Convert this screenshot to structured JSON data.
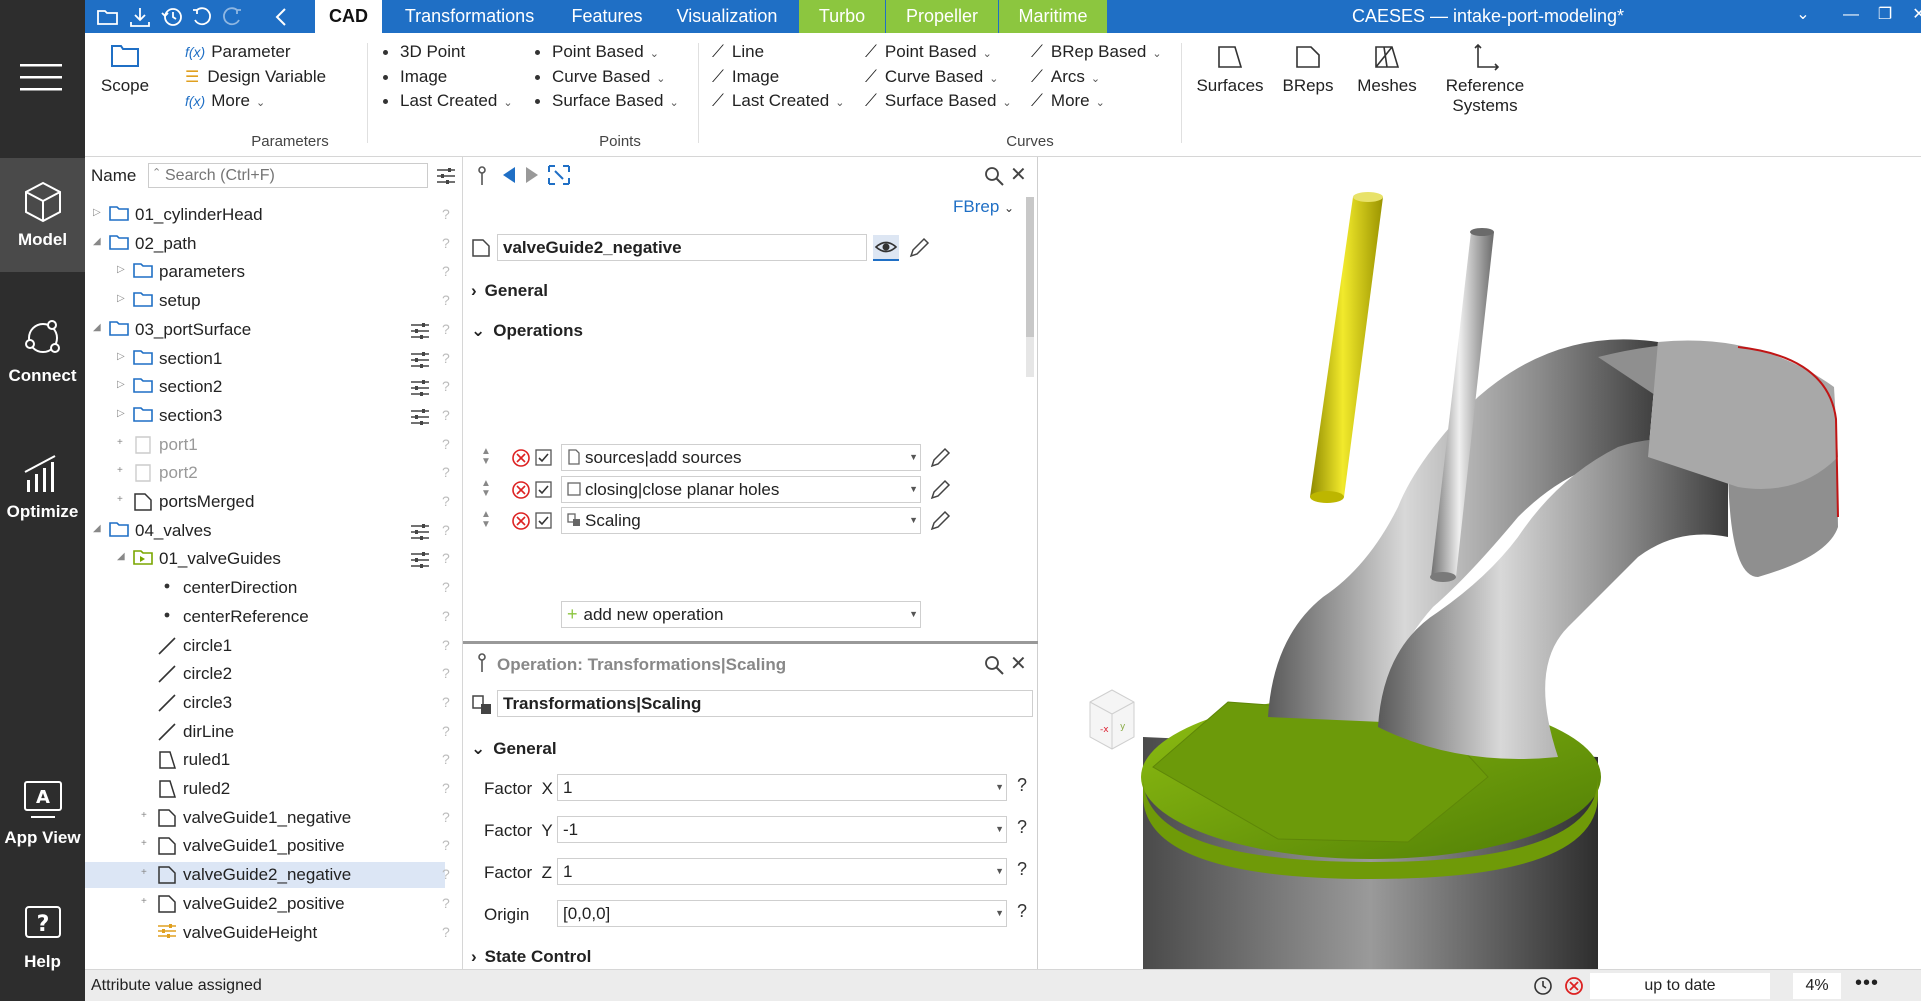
{
  "app": {
    "title": "CAESES — intake-port-modeling*"
  },
  "sidebar": {
    "items": [
      {
        "label": "Model"
      },
      {
        "label": "Connect"
      },
      {
        "label": "Optimize"
      },
      {
        "label": "App View"
      },
      {
        "label": "Help"
      }
    ]
  },
  "tabs": [
    "CAD",
    "Transformations",
    "Features",
    "Visualization",
    "Turbo",
    "Propeller",
    "Maritime"
  ],
  "ribbon": {
    "scope": "Scope",
    "parameters": {
      "items": [
        "Parameter",
        "Design Variable",
        "More"
      ],
      "group": "Parameters"
    },
    "points": {
      "col1": [
        "3D Point",
        "Image",
        "Last Created"
      ],
      "col2": [
        "Point Based",
        "Curve Based",
        "Surface Based"
      ],
      "group": "Points"
    },
    "curves": {
      "col1": [
        "Line",
        "Image",
        "Last Created"
      ],
      "col2": [
        "Point Based",
        "Curve Based",
        "Surface Based"
      ],
      "col3": [
        "BRep Based",
        "Arcs",
        "More"
      ],
      "group": "Curves"
    },
    "big": [
      "Surfaces",
      "BReps",
      "Meshes",
      "Reference",
      "Systems"
    ]
  },
  "tree": {
    "name_label": "Name",
    "search_placeholder": "Search (Ctrl+F)",
    "rows": [
      "01_cylinderHead",
      "02_path",
      "parameters",
      "setup",
      "03_portSurface",
      "section1",
      "section2",
      "section3",
      "port1",
      "port2",
      "portsMerged",
      "04_valves",
      "01_valveGuides",
      "centerDirection",
      "centerReference",
      "circle1",
      "circle2",
      "circle3",
      "dirLine",
      "ruled1",
      "ruled2",
      "valveGuide1_negative",
      "valveGuide1_positive",
      "valveGuide2_negative",
      "valveGuide2_positive",
      "valveGuideHeight"
    ]
  },
  "props": {
    "type_link": "FBrep",
    "object_name": "valveGuide2_negative",
    "general": "General",
    "operations": "Operations",
    "op_rows": [
      "sources|add sources",
      "closing|close planar holes",
      "Scaling"
    ],
    "add_op": "add new operation",
    "operation_title": "Operation: Transformations|Scaling",
    "operation_name": "Transformations|Scaling",
    "general2": "General",
    "factor_x_label": "Factor  X",
    "factor_x": "1",
    "factor_y_label": "Factor  Y",
    "factor_y": "-1",
    "factor_z_label": "Factor  Z",
    "factor_z": "1",
    "origin_label": "Origin",
    "origin": "[0,0,0]",
    "state_control": "State Control"
  },
  "status": {
    "message": "Attribute value assigned",
    "state": "up to date",
    "zoom": "4%"
  },
  "colors": {
    "accent": "#1f6fc5",
    "green_tab": "#8cc63f",
    "sidebar": "#2d2d2d",
    "selection": "#dce6f5"
  }
}
